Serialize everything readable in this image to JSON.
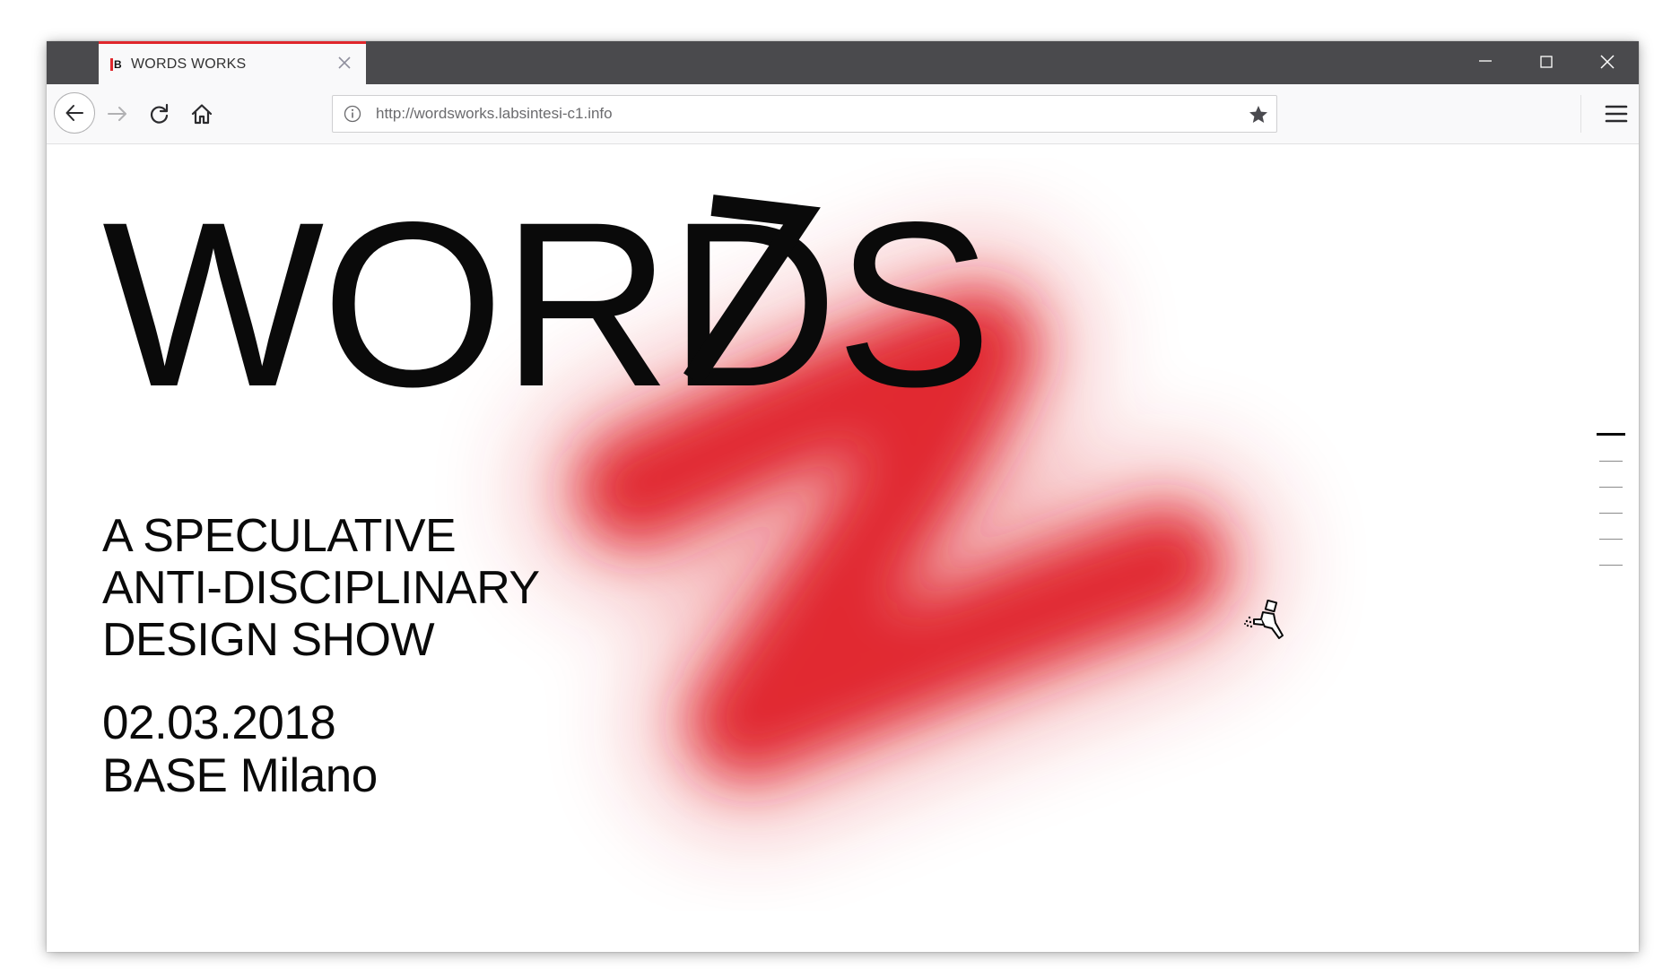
{
  "browser": {
    "tab": {
      "favicon": "B",
      "title": "WORDS WORKS",
      "close_icon": "close-icon"
    },
    "window_controls": [
      "minimize-icon",
      "maximize-icon",
      "close-icon"
    ],
    "toolbar": {
      "back_icon": "arrow-left-icon",
      "forward_icon": "arrow-right-icon",
      "reload_icon": "reload-icon",
      "home_icon": "home-icon",
      "url": "http://wordsworks.labsintesi-c1.info",
      "info_icon": "info-icon",
      "bookmark_icon": "star-icon",
      "menu_icon": "hamburger-menu-icon"
    }
  },
  "page": {
    "hero_title": "WORDS",
    "tagline": [
      "A SPECULATIVE",
      "ANTI-DISCIPLINARY",
      "DESIGN SHOW"
    ],
    "date": "02.03.2018",
    "venue": "BASE Milano",
    "section_nav": {
      "count": 6,
      "active_index": 0
    },
    "cursor_icon": "spray-gun-cursor-icon",
    "colors": {
      "spray": "#e0242b",
      "text": "#0a0a0a",
      "tab_accent": "#e0272c",
      "titlebar": "#4a4a4d"
    }
  }
}
